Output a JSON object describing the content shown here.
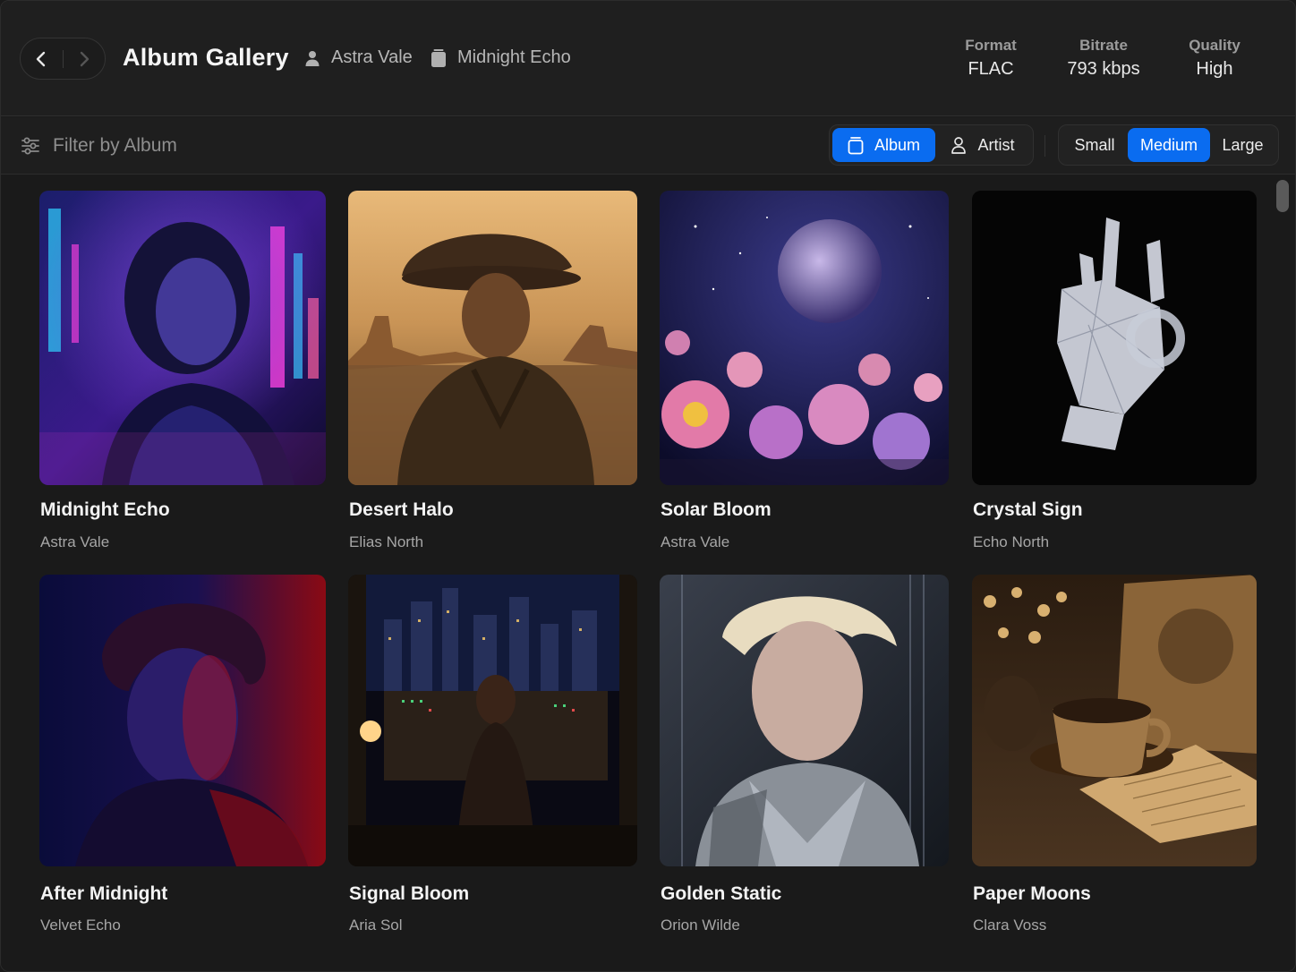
{
  "header": {
    "title": "Album Gallery",
    "artist": "Astra Vale",
    "album": "Midnight Echo",
    "stats": [
      {
        "label": "Format",
        "value": "FLAC"
      },
      {
        "label": "Bitrate",
        "value": "793 kbps"
      },
      {
        "label": "Quality",
        "value": "High"
      }
    ]
  },
  "toolbar": {
    "filter_placeholder": "Filter by Album",
    "group_by": [
      {
        "label": "Album",
        "icon": "album-icon",
        "active": true
      },
      {
        "label": "Artist",
        "icon": "person-icon",
        "active": false
      }
    ],
    "sizes": [
      {
        "label": "Small",
        "active": false
      },
      {
        "label": "Medium",
        "active": true
      },
      {
        "label": "Large",
        "active": false
      }
    ]
  },
  "albums": [
    {
      "title": "Midnight Echo",
      "artist": "Astra Vale",
      "art": "neon-city-portrait"
    },
    {
      "title": "Desert Halo",
      "artist": "Elias North",
      "art": "desert-cowboy"
    },
    {
      "title": "Solar Bloom",
      "artist": "Astra Vale",
      "art": "moon-flowers"
    },
    {
      "title": "Crystal Sign",
      "artist": "Echo North",
      "art": "crystal-hand"
    },
    {
      "title": "After Midnight",
      "artist": "Velvet Echo",
      "art": "red-blue-portrait"
    },
    {
      "title": "Signal Bloom",
      "artist": "Aria Sol",
      "art": "night-studio"
    },
    {
      "title": "Golden Static",
      "artist": "Orion Wilde",
      "art": "blond-portrait"
    },
    {
      "title": "Paper Moons",
      "artist": "Clara Voss",
      "art": "coffee-still-life"
    }
  ],
  "colors": {
    "accent": "#0a6cf0",
    "background": "#1a1a1a",
    "header": "#1f1f1f"
  }
}
